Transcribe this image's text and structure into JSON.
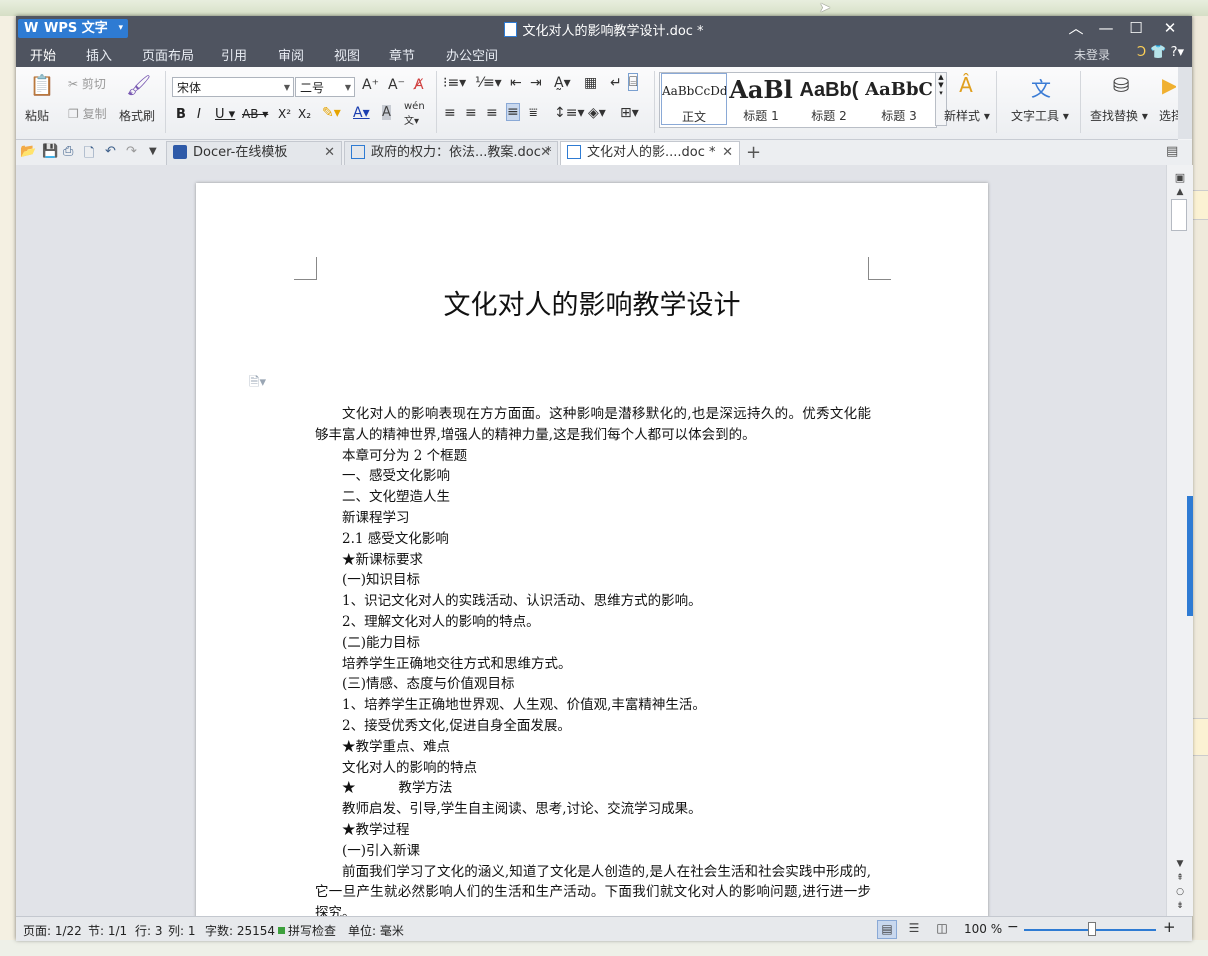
{
  "app": {
    "name": "WPS 文字",
    "window_title": "文化对人的影响教学设计.doc *"
  },
  "ribbon_tabs": [
    "开始",
    "插入",
    "页面布局",
    "引用",
    "审阅",
    "视图",
    "章节",
    "办公空间"
  ],
  "account": {
    "login": "未登录"
  },
  "ribbon": {
    "paste": "粘贴",
    "cut": "剪切",
    "copy": "复制",
    "format_painter": "格式刷",
    "font_name": "宋体",
    "font_size": "二号",
    "styles": [
      {
        "preview": "AaBbCcDd",
        "name": "正文"
      },
      {
        "preview": "AaBl",
        "name": "标题 1"
      },
      {
        "preview": "AaBb(",
        "name": "标题 2"
      },
      {
        "preview": "AaBbC",
        "name": "标题 3"
      }
    ],
    "new_style": "新样式",
    "text_tools": "文字工具",
    "find_replace": "查找替换",
    "select": "选择"
  },
  "doc_tabs": [
    {
      "label": "Docer-在线模板"
    },
    {
      "label": "政府的权力：依法...教案.doc *"
    },
    {
      "label": "文化对人的影....doc *"
    }
  ],
  "document": {
    "title": "文化对人的影响教学设计",
    "para1": "文化对人的影响表现在方方面面。这种影响是潜移默化的,也是深远持久的。优秀文化能够丰富人的精神世界,增强人的精神力量,这是我们每个人都可以体会到的。",
    "lines": [
      "本章可分为 2 个框题",
      "一、感受文化影响",
      "二、文化塑造人生",
      "新课程学习",
      "2.1    感受文化影响",
      "★新课标要求",
      "(一)知识目标",
      "1、识记文化对人的实践活动、认识活动、思维方式的影响。",
      "2、理解文化对人的影响的特点。",
      "(二)能力目标",
      "培养学生正确地交往方式和思维方式。",
      "(三)情感、态度与价值观目标",
      "1、培养学生正确地世界观、人生观、价值观,丰富精神生活。",
      "2、接受优秀文化,促进自身全面发展。",
      "★教学重点、难点",
      "文化对人的影响的特点",
      "★          教学方法",
      "教师启发、引导,学生自主阅读、思考,讨论、交流学习成果。",
      "★教学过程",
      "(一)引入新课"
    ],
    "para_last": "前面我们学习了文化的涵义,知道了文化是人创造的,是人在社会生活和社会实践中形成的,它一旦产生就必然影响人们的生活和生产活动。下面我们就文化对人的影响问题,进行进一步探究。"
  },
  "status": {
    "page": "页面: 1/22",
    "section": "节: 1/1",
    "row": "行: 3",
    "col": "列: 1",
    "words": "字数: 25154",
    "spell": "拼写检查",
    "unit": "单位: 毫米",
    "zoom": "100 %"
  },
  "colors": {
    "accent": "#2e7bd3",
    "titlebar": "#4f5460"
  },
  "icons": [
    "wps-logo-icon",
    "minimize-icon",
    "maximize-icon",
    "close-icon",
    "paste-icon",
    "scissors-icon",
    "copy-icon",
    "format-brush-icon",
    "save-icon",
    "undo-icon",
    "redo-icon",
    "print-icon",
    "find-icon",
    "plus-icon"
  ]
}
